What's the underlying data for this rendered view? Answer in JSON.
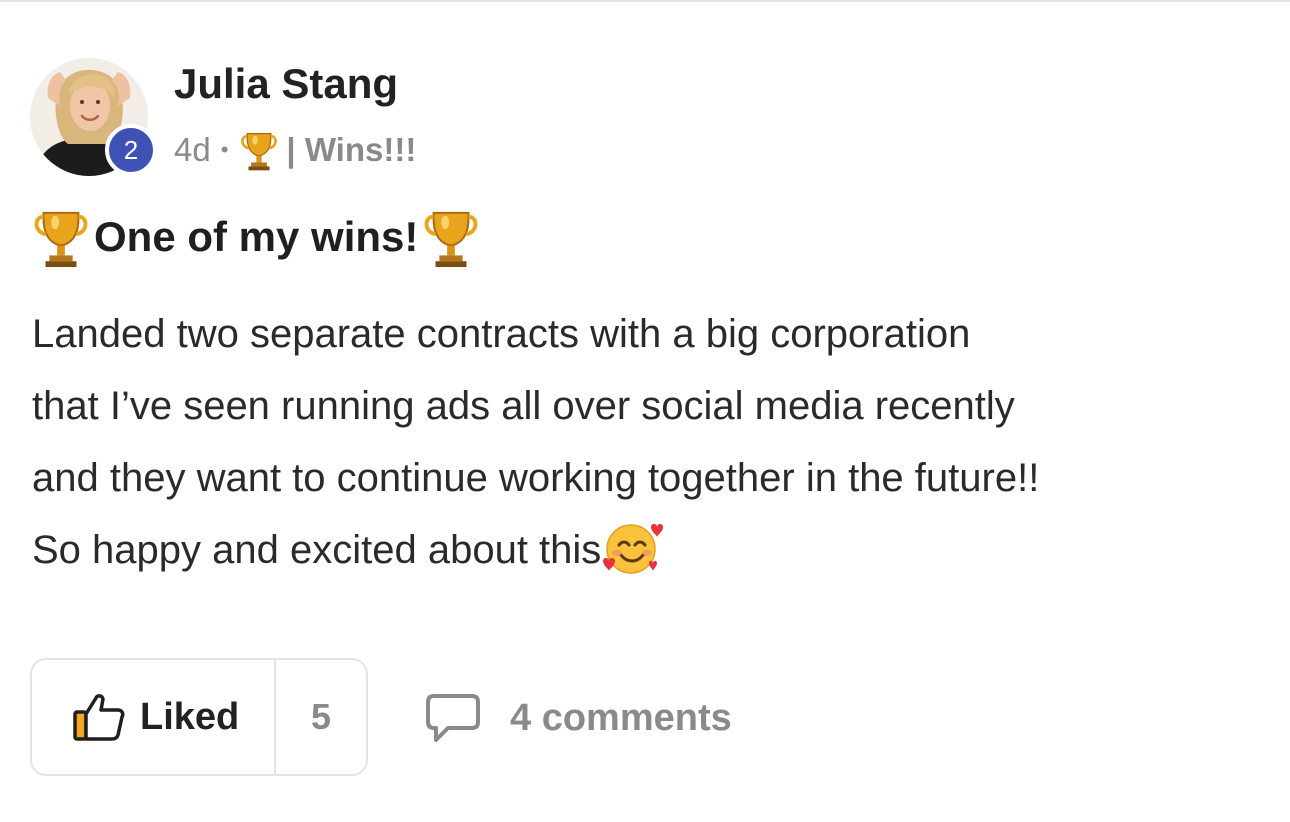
{
  "post": {
    "author": {
      "name": "Julia Stang",
      "level": "2",
      "avatar_icon": "profile-photo"
    },
    "meta": {
      "age": "4d",
      "separator": "•",
      "category_icon": "trophy-icon",
      "category": "| Wins!!!"
    },
    "title": {
      "leading_icon": "trophy-icon",
      "text": "One of my wins!",
      "trailing_icon": "trophy-icon"
    },
    "body": {
      "lines": [
        "Landed two separate contracts with a big corporation",
        "that I’ve seen running ads all over social media recently",
        "and they want to continue working together in the future!!",
        "So happy and excited about this"
      ],
      "trailing_emoji": "smiling-face-with-hearts-emoji"
    },
    "actions": {
      "like_label": "Liked",
      "like_count": "5",
      "like_icon": "thumbs-up-icon",
      "comments_icon": "comment-bubble-icon",
      "comments_label": "4 comments"
    }
  },
  "colors": {
    "level_badge": "#3f51b5",
    "trophy_gold": "#e8a41c",
    "muted_text": "#8a8a8a",
    "border": "#e4e4e4"
  }
}
